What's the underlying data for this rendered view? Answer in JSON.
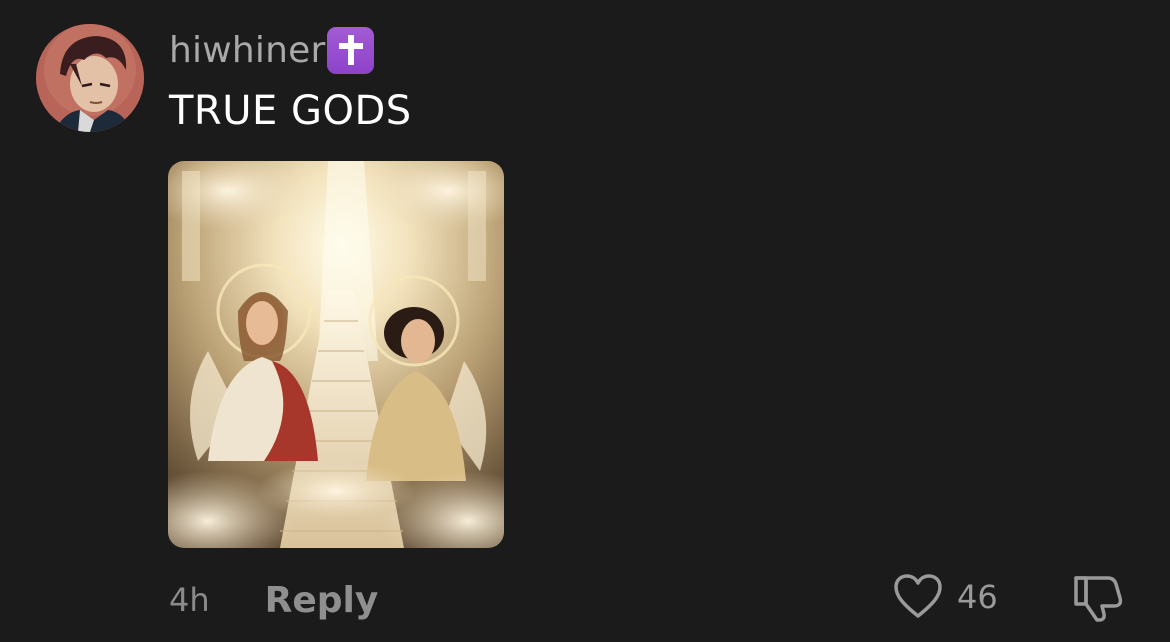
{
  "comment": {
    "username": "hiwhiner",
    "badge_icon": "latin-cross-icon",
    "badge_color": "#9b52d2",
    "text": "TRUE GODS",
    "attachment_icon": "image-attachment",
    "timestamp": "4h",
    "reply_label": "Reply",
    "like_count": "46",
    "like_icon": "heart-outline-icon",
    "dislike_icon": "thumbs-down-outline-icon"
  },
  "colors": {
    "background": "#1b1b1b",
    "username": "#a9a9a9",
    "text": "#ffffff",
    "muted": "#8a8a8a"
  }
}
